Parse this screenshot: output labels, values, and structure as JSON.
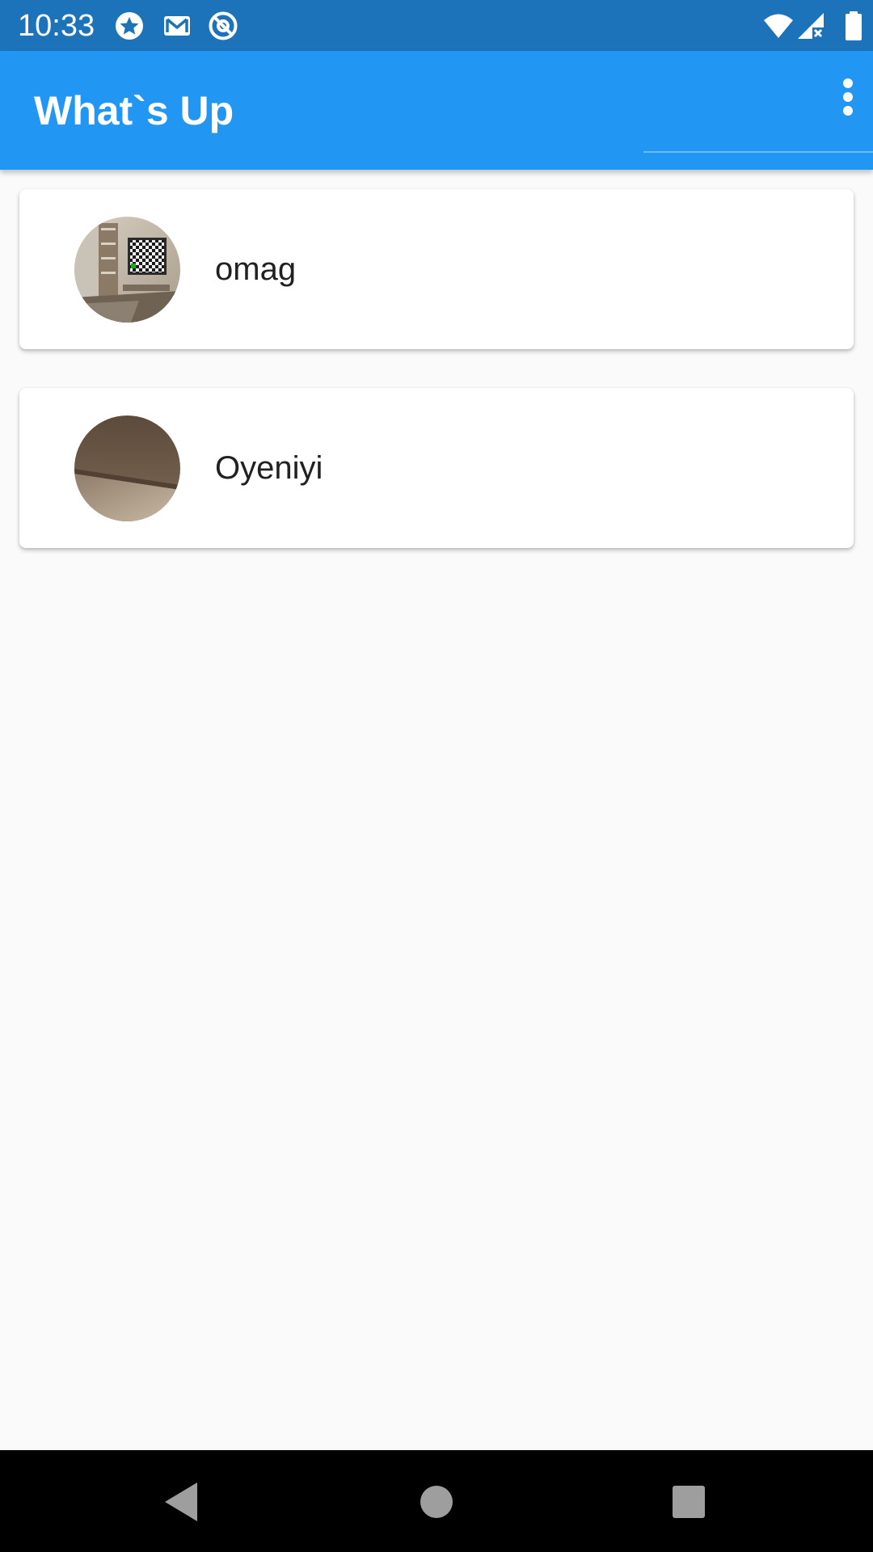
{
  "status_bar": {
    "time": "10:33",
    "left_icons": [
      "star-circle-icon",
      "gmail-icon",
      "at-sign-circle-icon"
    ],
    "right_icons": [
      "wifi-icon",
      "cell-signal-no-data-icon",
      "battery-icon"
    ]
  },
  "app_bar": {
    "title": "What`s Up",
    "menu_icon": "more-vert-icon",
    "color": "#2196f3"
  },
  "chats": [
    {
      "name": "omag",
      "avatar": "room-photo-avatar"
    },
    {
      "name": "Oyeniyi",
      "avatar": "wall-photo-avatar"
    }
  ],
  "nav_bar": {
    "buttons": [
      "back-icon",
      "home-icon",
      "recents-icon"
    ]
  },
  "colors": {
    "status_bar": "#1d73b9",
    "app_bar": "#2196f3",
    "background": "#fafafa",
    "card": "#ffffff"
  }
}
